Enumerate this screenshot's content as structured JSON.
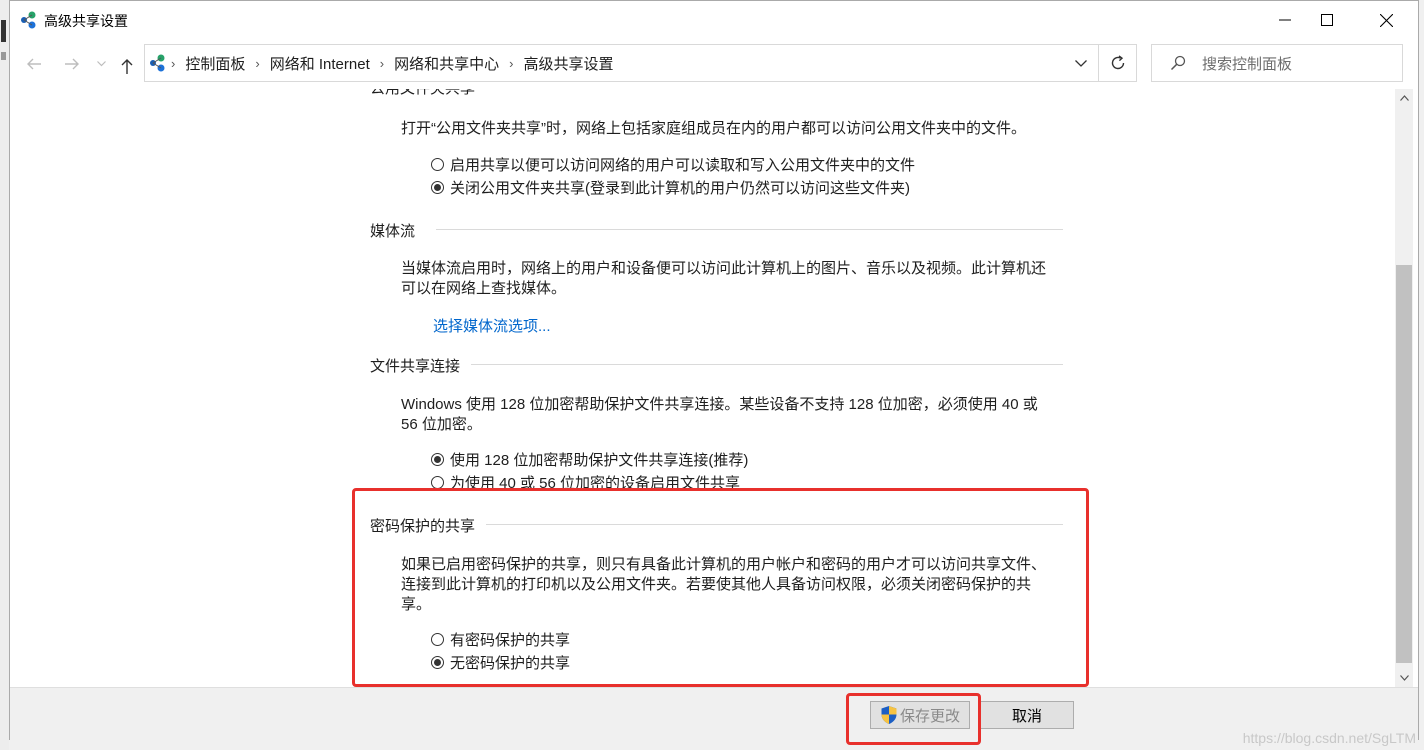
{
  "window": {
    "title": "高级共享设置"
  },
  "address": {
    "breadcrumbs": [
      "控制面板",
      "网络和 Internet",
      "网络和共享中心",
      "高级共享设置"
    ]
  },
  "search": {
    "placeholder": "搜索控制面板"
  },
  "sections": {
    "public_folder": {
      "heading": "公用文件夹共享",
      "description": "打开“公用文件夹共享”时，网络上包括家庭组成员在内的用户都可以访问公用文件夹中的文件。",
      "options": [
        {
          "label": "启用共享以便可以访问网络的用户可以读取和写入公用文件夹中的文件",
          "checked": false
        },
        {
          "label": "关闭公用文件夹共享(登录到此计算机的用户仍然可以访问这些文件夹)",
          "checked": true
        }
      ]
    },
    "media": {
      "heading": "媒体流",
      "description_line1": "当媒体流启用时，网络上的用户和设备便可以访问此计算机上的图片、音乐以及视频。此计算机还",
      "description_line2": "可以在网络上查找媒体。",
      "link": "选择媒体流选项..."
    },
    "encryption": {
      "heading": "文件共享连接",
      "description_line1": "Windows 使用 128 位加密帮助保护文件共享连接。某些设备不支持 128 位加密，必须使用 40 或",
      "description_line2": "56 位加密。",
      "options": [
        {
          "label": "使用 128 位加密帮助保护文件共享连接(推荐)",
          "checked": true
        },
        {
          "label": "为使用 40 或 56 位加密的设备启用文件共享",
          "checked": false
        }
      ]
    },
    "password": {
      "heading": "密码保护的共享",
      "description_line1": "如果已启用密码保护的共享，则只有具备此计算机的用户帐户和密码的用户才可以访问共享文件、",
      "description_line2": "连接到此计算机的打印机以及公用文件夹。若要使其他人具备访问权限，必须关闭密码保护的共",
      "description_line3": "享。",
      "options": [
        {
          "label": "有密码保护的共享",
          "checked": false
        },
        {
          "label": "无密码保护的共享",
          "checked": true
        }
      ]
    }
  },
  "buttons": {
    "save": "保存更改",
    "cancel": "取消"
  },
  "watermark": "https://blog.csdn.net/SgLTM",
  "colors": {
    "link": "#0066cc",
    "highlight": "#e8302c"
  }
}
